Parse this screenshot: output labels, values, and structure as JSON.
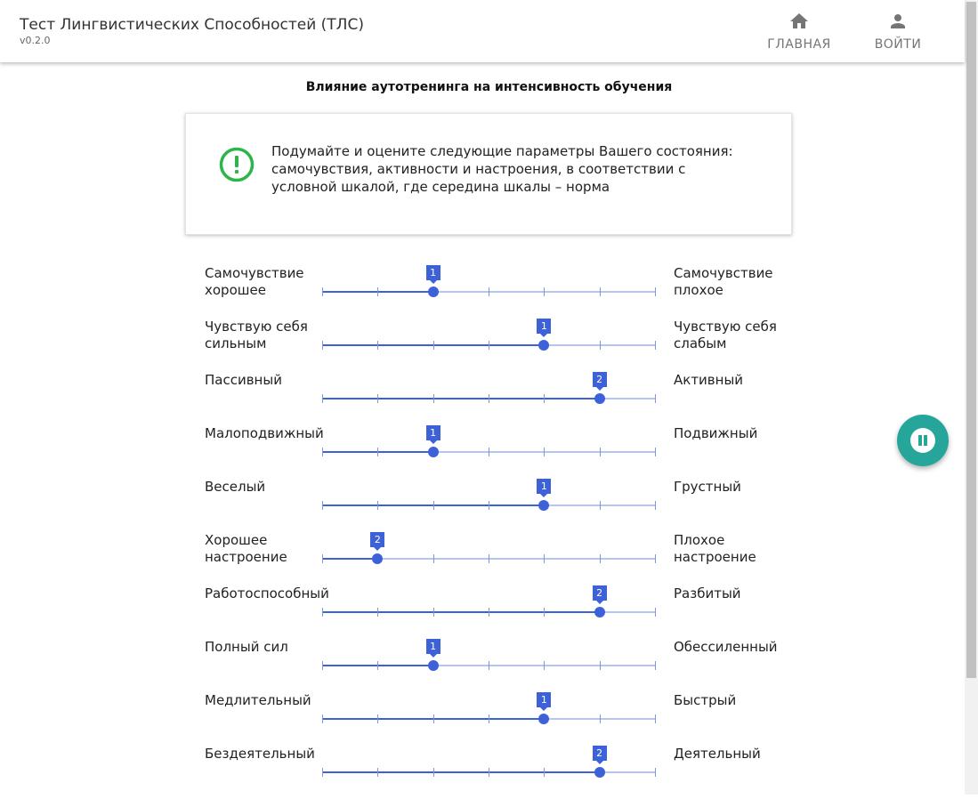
{
  "header": {
    "title": "Тест Лингвистических Способностей (ТЛС)",
    "version": "v0.2.0",
    "nav": [
      {
        "label": "ГЛАВНАЯ",
        "icon": "home-icon"
      },
      {
        "label": "ВОЙТИ",
        "icon": "person-icon"
      }
    ]
  },
  "page": {
    "title": "Влияние аутотренинга на интенсивность обучения",
    "info_text": "Подумайте и оцените следующие параметры Вашего состояния: самочувствия, активности и настроения, в соответствии с условной шкалой, где середина шкалы – норма",
    "info_icon": "exclamation-circle-icon"
  },
  "scale": {
    "ticks": 7,
    "accent_color": "#3d62d8"
  },
  "sliders": [
    {
      "left": "Самочувствие хорошее",
      "right": "Самочувствие плохое",
      "position": 2,
      "badge": "1"
    },
    {
      "left": "Чувствую себя сильным",
      "right": "Чувствую себя слабым",
      "position": 4,
      "badge": "1"
    },
    {
      "left": "Пассивный",
      "right": "Активный",
      "position": 5,
      "badge": "2"
    },
    {
      "left": "Малоподвижный",
      "right": "Подвижный",
      "position": 2,
      "badge": "1"
    },
    {
      "left": "Веселый",
      "right": "Грустный",
      "position": 4,
      "badge": "1"
    },
    {
      "left": "Хорошее настроение",
      "right": "Плохое настроение",
      "position": 1,
      "badge": "2"
    },
    {
      "left": "Работоспособный",
      "right": "Разбитый",
      "position": 5,
      "badge": "2"
    },
    {
      "left": "Полный сил",
      "right": "Обессиленный",
      "position": 2,
      "badge": "1"
    },
    {
      "left": "Медлительный",
      "right": "Быстрый",
      "position": 4,
      "badge": "1"
    },
    {
      "left": "Бездеятельный",
      "right": "Деятельный",
      "position": 5,
      "badge": "2"
    }
  ],
  "fab": {
    "icon": "pause-icon",
    "color": "#26a69a"
  }
}
